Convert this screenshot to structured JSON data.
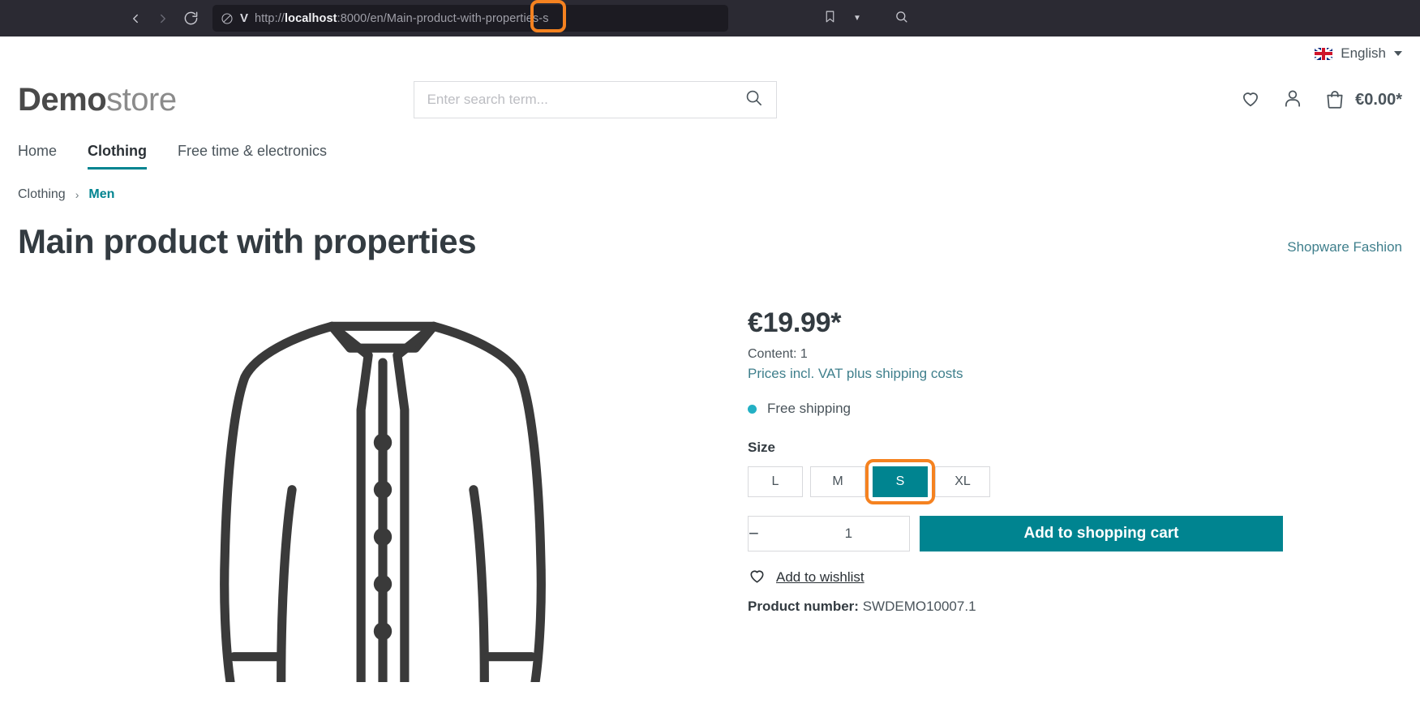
{
  "browser": {
    "back_icon": "chevron-left-icon",
    "forward_icon": "chevron-right-icon",
    "reload_icon": "reload-icon",
    "shield_icon": "shield-off-icon",
    "v_icon": "V",
    "url_scheme": "http://",
    "url_host": "localhost",
    "url_rest": ":8000/en/Main-product-with-properties-s",
    "bookmark_icon": "bookmark-icon",
    "dropdown_icon": "chevron-down-icon",
    "search_icon": "search-icon"
  },
  "topbar": {
    "language": "English",
    "flag": "uk-flag-icon"
  },
  "header": {
    "logo_bold": "Demo",
    "logo_light": "store",
    "search_placeholder": "Enter search term...",
    "search_value": "",
    "search_icon": "search-icon",
    "wishlist_icon": "heart-icon",
    "account_icon": "person-icon",
    "cart_icon": "bag-icon",
    "cart_total": "€0.00*"
  },
  "nav": {
    "items": [
      {
        "label": "Home",
        "active": false
      },
      {
        "label": "Clothing",
        "active": true
      },
      {
        "label": "Free time & electronics",
        "active": false
      }
    ]
  },
  "breadcrumb": {
    "parent": "Clothing",
    "separator": "›",
    "current": "Men"
  },
  "product": {
    "title": "Main product with properties",
    "manufacturer": "Shopware Fashion",
    "image_alt": "jacket-illustration",
    "price": "€19.99*",
    "content": "Content: 1",
    "vat_note": "Prices incl. VAT plus shipping costs",
    "delivery": "Free shipping",
    "size_label": "Size",
    "sizes": [
      {
        "label": "L",
        "selected": false
      },
      {
        "label": "M",
        "selected": false
      },
      {
        "label": "S",
        "selected": true
      },
      {
        "label": "XL",
        "selected": false
      }
    ],
    "qty_minus": "−",
    "qty_value": "1",
    "qty_plus": "+",
    "add_to_cart": "Add to shopping cart",
    "wishlist_label": "Add to wishlist",
    "product_number_label": "Product number:",
    "product_number_value": "SWDEMO10007.1"
  },
  "colors": {
    "accent_teal": "#008490",
    "highlight_orange": "#f58220",
    "dot_cyan": "#23b0c4",
    "link_teal": "#3f7f8c"
  }
}
